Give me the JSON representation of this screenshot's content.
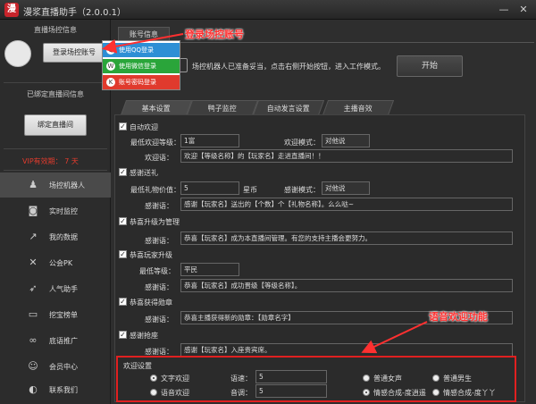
{
  "app": {
    "title": "漫浆直播助手（2.0.0.1）",
    "logo_icon": "app-logo-icon"
  },
  "window_controls": {
    "minimize": "—",
    "close": "✕"
  },
  "sidebar": {
    "live_control_header": "直播场控信息",
    "login_button": "登录场控账号",
    "bound_header": "已绑定直播间信息",
    "bind_button": "绑定直播间",
    "vip_text": "VIP有效期： 7 天",
    "items": [
      {
        "label": "场控机器人",
        "icon": "robot-icon",
        "active": true
      },
      {
        "label": "实时监控",
        "icon": "camera-icon",
        "active": false
      },
      {
        "label": "我的数据",
        "icon": "chart-icon",
        "active": false
      },
      {
        "label": "公会PK",
        "icon": "swords-icon",
        "active": false
      },
      {
        "label": "人气助手",
        "icon": "rocket-icon",
        "active": false
      },
      {
        "label": "挖宝榜单",
        "icon": "monitor-icon",
        "active": false
      },
      {
        "label": "底语推广",
        "icon": "link-icon",
        "active": false
      },
      {
        "label": "会员中心",
        "icon": "user-group-icon",
        "active": false
      },
      {
        "label": "联系我们",
        "icon": "headset-icon",
        "active": false
      }
    ]
  },
  "account": {
    "tab_label": "账号信息",
    "ready_text": "场控机器人已准备妥当，点击右侧开始按钮，进入工作模式。",
    "start_button": "开始"
  },
  "login_menu": [
    {
      "label": "使用QQ登录",
      "color": "#2d8fd5",
      "icon": "qq-icon"
    },
    {
      "label": "使用微信登录",
      "color": "#2aa53a",
      "icon": "wechat-icon"
    },
    {
      "label": "账号密码登录",
      "color": "#e03a2d",
      "icon": "key-icon"
    }
  ],
  "tabs": [
    {
      "label": "基本设置",
      "active": true
    },
    {
      "label": "鸭子监控",
      "active": false
    },
    {
      "label": "自动发言设置",
      "active": false
    },
    {
      "label": "主播音效",
      "active": false
    }
  ],
  "settings": {
    "auto_welcome": {
      "label": "自动欢迎",
      "checked": true,
      "min_level_label": "最低欢迎等级：",
      "min_level_value": "1富",
      "mode_label": "欢迎模式：",
      "mode_value": "对他说",
      "words_label": "欢迎语：",
      "words_value": "欢迎【等级名称】的【玩家名】走进直播间！！"
    },
    "thank_gift": {
      "label": "感谢送礼",
      "checked": true,
      "min_gift_label": "最低礼物价值：",
      "min_gift_value": "5",
      "unit": "星币",
      "mode_label": "感谢模式：",
      "mode_value": "对他说",
      "words_label": "感谢语：",
      "words_value": "感谢【玩家名】送出的【个数】个【礼物名称】。么么哒~"
    },
    "congrats_admin": {
      "label": "恭喜升级为管理",
      "checked": true,
      "words_label": "感谢语：",
      "words_value": "恭喜【玩家名】成为本直播间管理。有您的支持主播会更努力。"
    },
    "congrats_levelup": {
      "label": "恭喜玩家升级",
      "checked": true,
      "min_level_label": "最低等级：",
      "min_level_value": "平民",
      "words_label": "感谢语：",
      "words_value": "恭喜【玩家名】成功晋级【等级名称】。"
    },
    "congrats_medal": {
      "label": "恭喜获得勋章",
      "checked": true,
      "words_label": "感谢语：",
      "words_value": "恭喜主播获得新的勋章：【勋章名字】"
    },
    "thank_seat": {
      "label": "感谢抢座",
      "checked": true,
      "words_label": "感谢语：",
      "words_value": "感谢【玩家名】入座贵宾席。"
    }
  },
  "welcome_settings": {
    "header": "欢迎设置",
    "text_welcome": "文字欢迎",
    "voice_welcome": "语音欢迎",
    "speed_label": "语速：",
    "speed_value": "5",
    "volume_label": "音调：",
    "volume_value": "5",
    "voices": [
      {
        "label": "普通女声",
        "on": false
      },
      {
        "label": "普通男生",
        "on": false
      },
      {
        "label": "情感合成-度逍遥",
        "on": true
      },
      {
        "label": "情感合成-度丫丫",
        "on": false
      }
    ]
  },
  "annotations": {
    "login_note": "登录场控账号",
    "voice_note": "语音欢迎功能",
    "color": "#ff3030"
  }
}
